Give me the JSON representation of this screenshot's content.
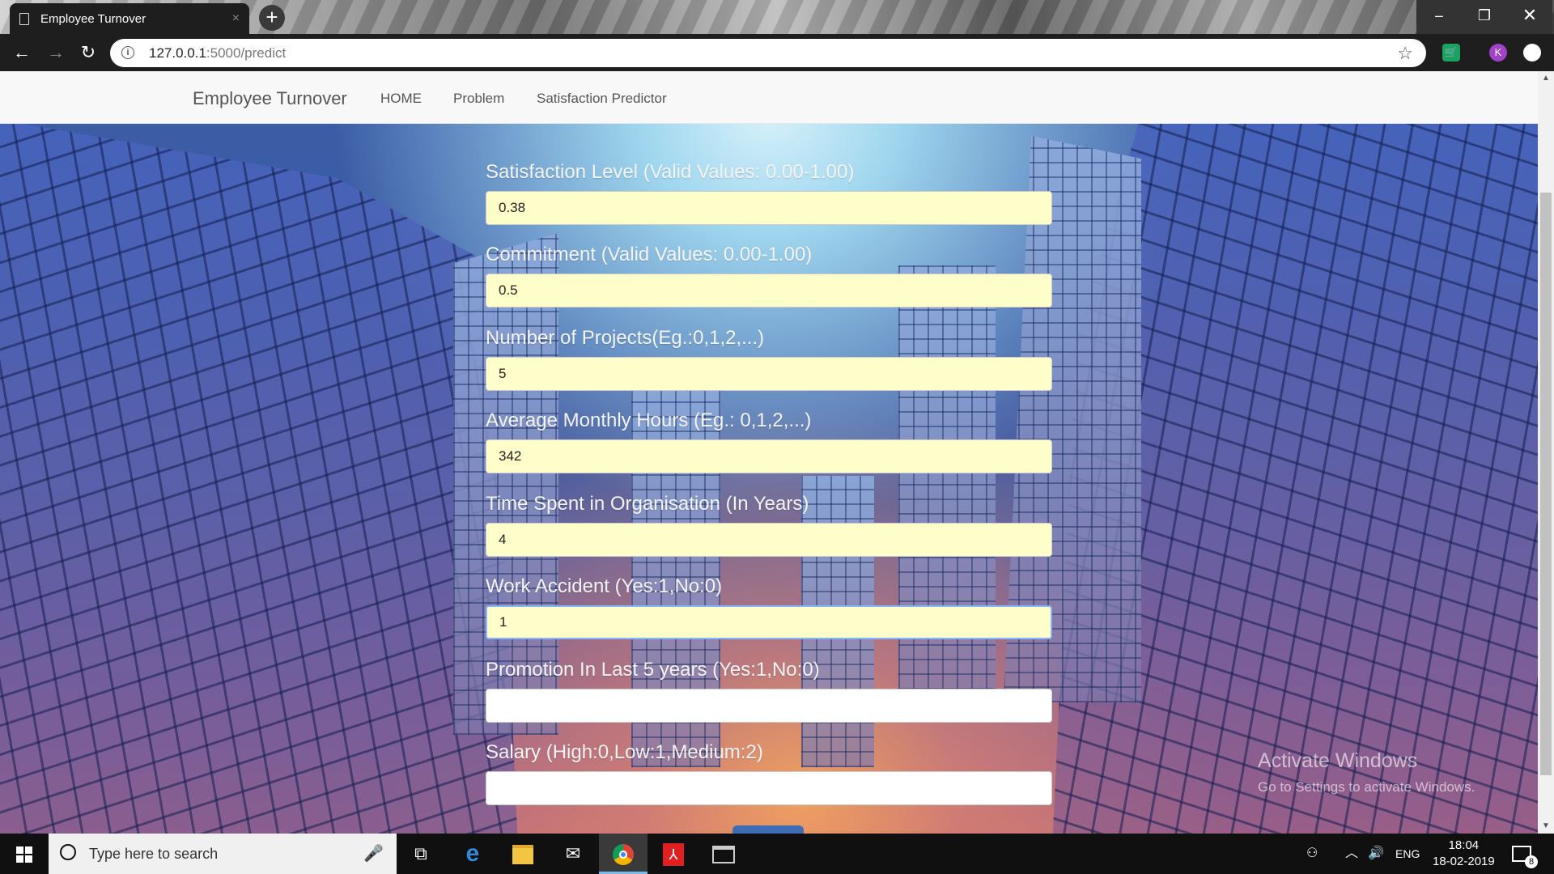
{
  "browser": {
    "tab_title": "Employee Turnover",
    "tab_close": "×",
    "new_tab": "+",
    "url_host": "127.0.0.1",
    "url_path": ":5000/predict",
    "window_controls": {
      "minimize": "–",
      "restore": "❐",
      "close": "✕"
    },
    "profile_initial": "K"
  },
  "site": {
    "brand": "Employee Turnover",
    "nav": [
      "HOME",
      "Problem",
      "Satisfaction Predictor"
    ]
  },
  "form": {
    "fields": [
      {
        "label": "Satisfaction Level (Valid Values: 0.00-1.00)",
        "value": "0.38"
      },
      {
        "label": "Commitment (Valid Values: 0.00-1.00)",
        "value": "0.5"
      },
      {
        "label": "Number of Projects(Eg.:0,1,2,...)",
        "value": "5"
      },
      {
        "label": "Average Monthly Hours (Eg.: 0,1,2,...)",
        "value": "342"
      },
      {
        "label": "Time Spent in Organisation (In Years)",
        "value": "4"
      },
      {
        "label": "Work Accident (Yes:1,No:0)",
        "value": "1"
      },
      {
        "label": "Promotion In Last 5 years (Yes:1,No:0)",
        "value": ""
      },
      {
        "label": "Salary (High:0,Low:1,Medium:2)",
        "value": ""
      }
    ]
  },
  "watermark": {
    "title": "Activate Windows",
    "subtitle": "Go to Settings to activate Windows."
  },
  "taskbar": {
    "search_placeholder": "Type here to search",
    "language": "ENG",
    "time": "18:04",
    "date": "18-02-2019",
    "notification_count": "8"
  },
  "colors": {
    "input_filled": "#fefeca",
    "focus_ring": "#8ab4f8",
    "label_text": "#f4f4f4"
  }
}
